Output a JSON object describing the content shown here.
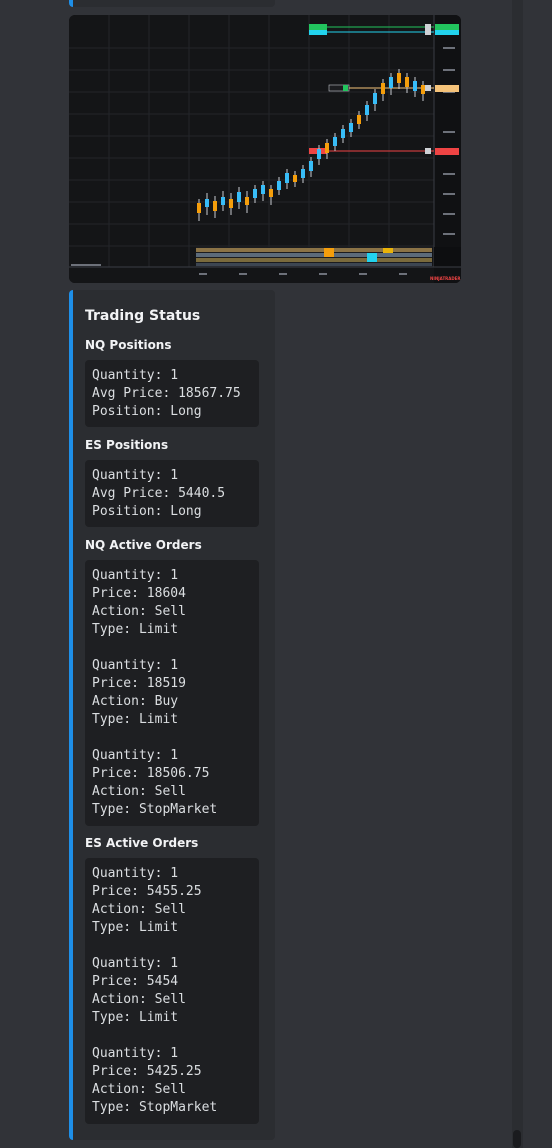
{
  "embed": {
    "title": "Trading Status",
    "fields": [
      {
        "name": "NQ Positions",
        "value": "Quantity: 1\nAvg Price: 18567.75\nPosition: Long"
      },
      {
        "name": "ES Positions",
        "value": "Quantity: 1\nAvg Price: 5440.5\nPosition: Long"
      },
      {
        "name": "NQ Active Orders",
        "value": "Quantity: 1\nPrice: 18604\nAction: Sell\nType: Limit\n\nQuantity: 1\nPrice: 18519\nAction: Buy\nType: Limit\n\nQuantity: 1\nPrice: 18506.75\nAction: Sell\nType: StopMarket"
      },
      {
        "name": "ES Active Orders",
        "value": "Quantity: 1\nPrice: 5455.25\nAction: Sell\nType: Limit\n\nQuantity: 1\nPrice: 5454\nAction: Sell\nType: Limit\n\nQuantity: 1\nPrice: 5425.25\nAction: Sell\nType: StopMarket"
      }
    ]
  },
  "chart_image": {
    "watermark": "NINJATRADER",
    "accent_colors": {
      "target_order": "#22c55e",
      "stop_order": "#ef4444",
      "position_line": "#f5c37a",
      "tag_cyan": "#22d3ee"
    }
  },
  "colors": {
    "embed_border": "#1e8fe8",
    "embed_bg": "#2b2d31",
    "code_bg": "#1e1f22",
    "page_bg": "#313338"
  }
}
